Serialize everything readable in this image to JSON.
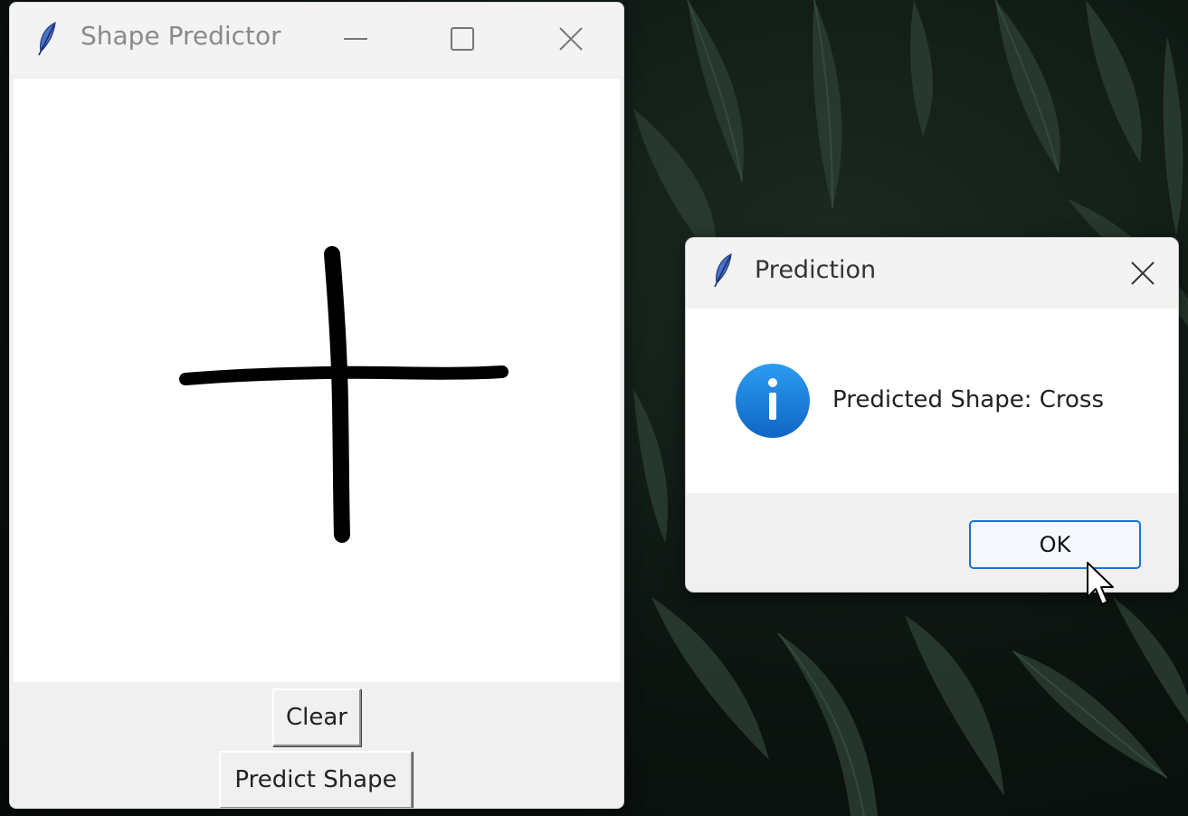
{
  "main_window": {
    "title": "Shape Predictor",
    "icon": "feather-icon",
    "controls": [
      "minimize-icon",
      "maximize-icon",
      "close-icon"
    ],
    "buttons": {
      "clear_label": "Clear",
      "predict_label": "Predict Shape"
    }
  },
  "dialog": {
    "title": "Prediction",
    "icon": "feather-icon",
    "message_icon": "info-icon",
    "message": "Predicted Shape: Cross",
    "ok_label": "OK"
  },
  "colors": {
    "ok_border": "#1a73d6",
    "info_blue": "#1a7fd8",
    "stroke": "#000000"
  }
}
